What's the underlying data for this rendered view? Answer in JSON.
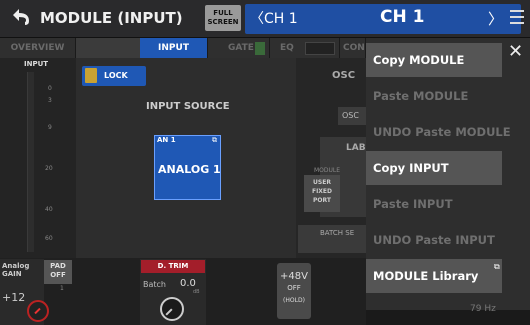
{
  "header": {
    "title": "MODULE (INPUT)",
    "full_screen_label": "FULL SCREEN",
    "channel_left": "CH 1",
    "channel_main": "CH 1",
    "prev_arrow": "〈",
    "next_arrow": "〉",
    "back_icon": "back-arrow-icon",
    "menu_icon": "hamburger-menu-icon"
  },
  "tabs": [
    {
      "label": "OVERVIEW",
      "active": false
    },
    {
      "label": "INPUT",
      "active": true
    },
    {
      "label": "GATE",
      "active": false
    },
    {
      "label": "EQ",
      "active": false
    },
    {
      "label": "CON",
      "active": false
    }
  ],
  "meter": {
    "label": "INPUT",
    "ticks": [
      "0",
      "3",
      "9",
      "20",
      "40",
      "60"
    ]
  },
  "input_panel": {
    "lock_label": "LOCK",
    "source_heading": "INPUT SOURCE",
    "source_port": "AN 1",
    "source_name": "ANALOG 1"
  },
  "side_panel": {
    "osc_label": "OSC",
    "osc_button": "OSC",
    "label_heading": "LABEL",
    "module_label": "MODULE",
    "user_button": "USER FIXED PORT",
    "batch_label": "BATCH SE"
  },
  "bottom": {
    "analog_gain": "Analog GAIN",
    "pad_label": "PAD",
    "pad_state": "OFF",
    "gain_value": "+12",
    "gain_small": "1",
    "dtrim_label": "D. TRIM",
    "dtrim_batch": "Batch",
    "dtrim_value": "0.0",
    "dtrim_unit": "dB",
    "phantom_label": "+48V",
    "phantom_state": "OFF",
    "phantom_hold": "(HOLD)",
    "freq_readout": "79 Hz"
  },
  "menu": {
    "items": [
      {
        "label": "Copy MODULE",
        "enabled": true
      },
      {
        "label": "Paste MODULE",
        "enabled": false
      },
      {
        "label": "UNDO Paste MODULE",
        "enabled": false
      },
      {
        "label": "Copy INPUT",
        "enabled": true
      },
      {
        "label": "Paste INPUT",
        "enabled": false
      },
      {
        "label": "UNDO Paste INPUT",
        "enabled": false
      },
      {
        "label": "MODULE Library",
        "enabled": true
      }
    ],
    "close_icon": "close-icon",
    "external_icon": "external-link-icon"
  },
  "colors": {
    "accent_blue": "#1f58b5",
    "dtrim_red": "#a31e2a",
    "lock_gold": "#c9a233"
  }
}
